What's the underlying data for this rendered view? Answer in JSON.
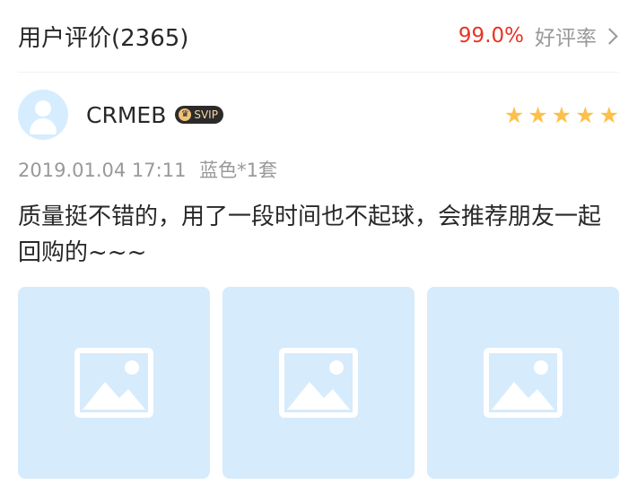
{
  "header": {
    "title": "用户评价(2365)",
    "rate": "99.0%",
    "rate_label": "好评率"
  },
  "review": {
    "username": "CRMEB",
    "badge": "SVIP",
    "stars": 5,
    "date": "2019.01.04 17:11",
    "sku": "蓝色*1套",
    "comment": "质量挺不错的，用了一段时间也不起球，会推荐朋友一起回购的~~~",
    "images": [
      "image-placeholder",
      "image-placeholder",
      "image-placeholder"
    ]
  },
  "colors": {
    "accent": "#e93323",
    "star": "#fdc04a",
    "placeholder_bg": "#d6ebfc",
    "muted_text": "#999999"
  }
}
